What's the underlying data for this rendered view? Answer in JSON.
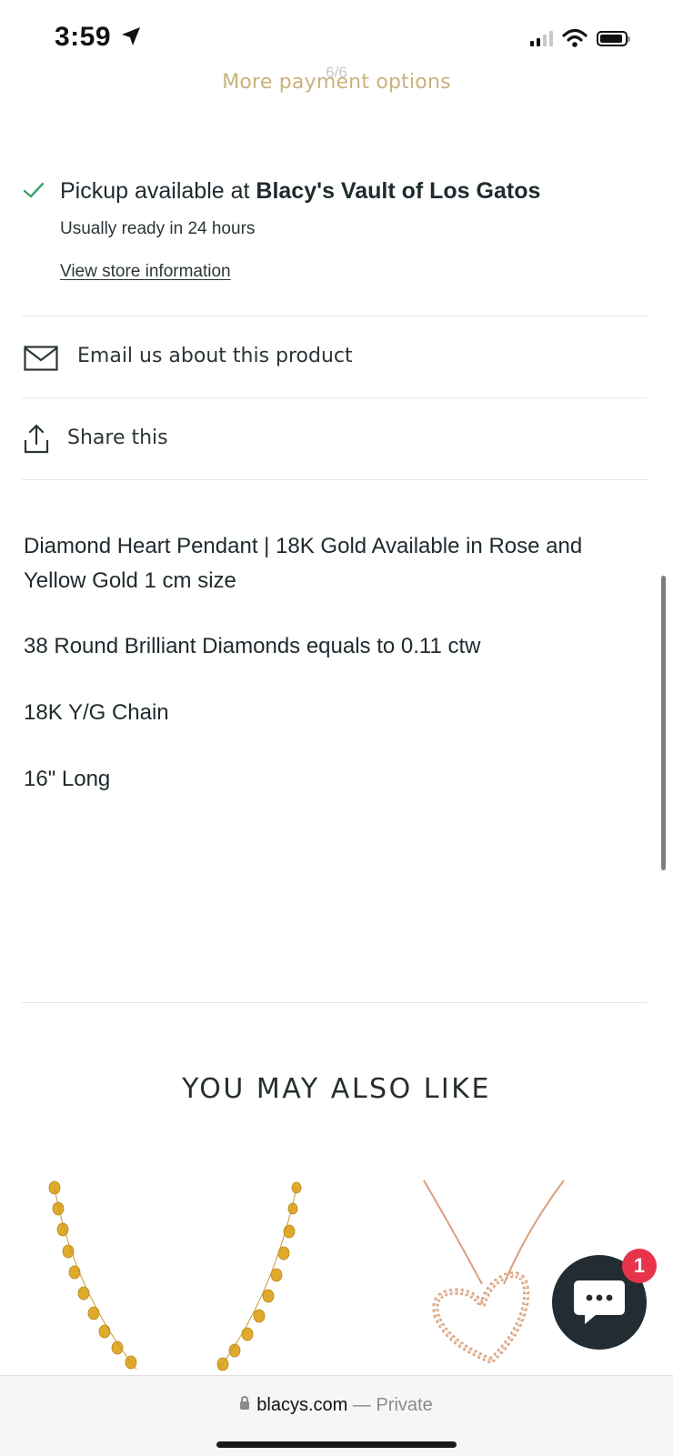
{
  "status_bar": {
    "time": "3:59"
  },
  "payment": {
    "more_options": "More payment options",
    "counter": "6/6"
  },
  "pickup": {
    "prefix": "Pickup available at ",
    "store": "Blacy's Vault of Los Gatos",
    "ready": "Usually ready in 24 hours",
    "view_store": "View store information"
  },
  "actions": {
    "email": "Email us about this product",
    "share": "Share this"
  },
  "description": [
    "Diamond Heart Pendant | 18K Gold Available in Rose and Yellow Gold 1 cm size",
    "38 Round Brilliant Diamonds equals to 0.11 ctw",
    "18K Y/G Chain",
    "16\" Long"
  ],
  "recommendations": {
    "heading": "YOU MAY ALSO LIKE"
  },
  "chat": {
    "badge": "1",
    "icon": "chat-bubble-icon"
  },
  "browser": {
    "domain": "blacys.com",
    "separator": "—",
    "mode": "Private"
  },
  "colors": {
    "accent_gold": "#c9b27c",
    "check_green": "#3aa36a",
    "chat_bg": "#232c33",
    "badge_red": "#e8344a",
    "rose_gold": "#d9a07a",
    "yellow_gold": "#e0aa2c"
  }
}
